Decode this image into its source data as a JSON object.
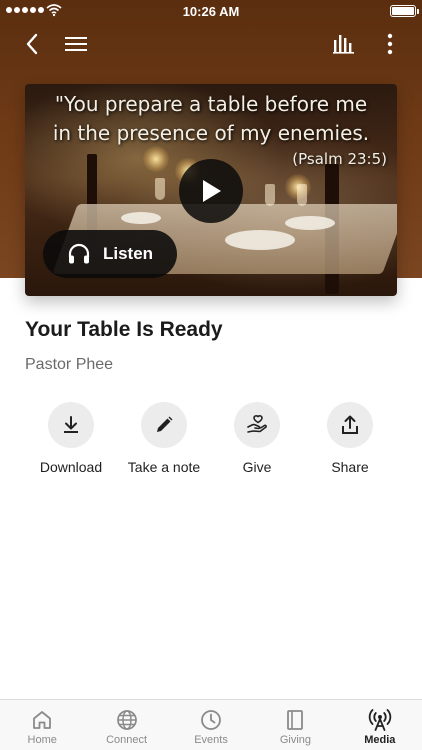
{
  "status_bar": {
    "time": "10:26 AM"
  },
  "nav": {
    "back_icon": "chevron-left-icon",
    "menu_icon": "hamburger-menu-icon",
    "equalizer_icon": "equalizer-icon",
    "more_icon": "more-vertical-icon"
  },
  "media": {
    "verse_line_1": "\"You prepare a table before me",
    "verse_line_2": "in the presence of my enemies.",
    "verse_reference": "(Psalm 23:5)",
    "listen_label": "Listen"
  },
  "sermon": {
    "title": "Your Table Is Ready",
    "speaker": "Pastor Phee"
  },
  "actions": [
    {
      "label": "Download",
      "icon": "download-icon"
    },
    {
      "label": "Take a note",
      "icon": "pencil-icon"
    },
    {
      "label": "Give",
      "icon": "give-heart-hand-icon"
    },
    {
      "label": "Share",
      "icon": "share-icon"
    }
  ],
  "tabs": [
    {
      "label": "Home",
      "icon": "home-icon",
      "active": false
    },
    {
      "label": "Connect",
      "icon": "globe-icon",
      "active": false
    },
    {
      "label": "Events",
      "icon": "clock-icon",
      "active": false
    },
    {
      "label": "Giving",
      "icon": "book-icon",
      "active": false
    },
    {
      "label": "Media",
      "icon": "broadcast-icon",
      "active": true
    }
  ],
  "colors": {
    "header_brown": "#6e3a16",
    "active_tab": "#222222",
    "inactive_tab": "#8a8a8a"
  }
}
